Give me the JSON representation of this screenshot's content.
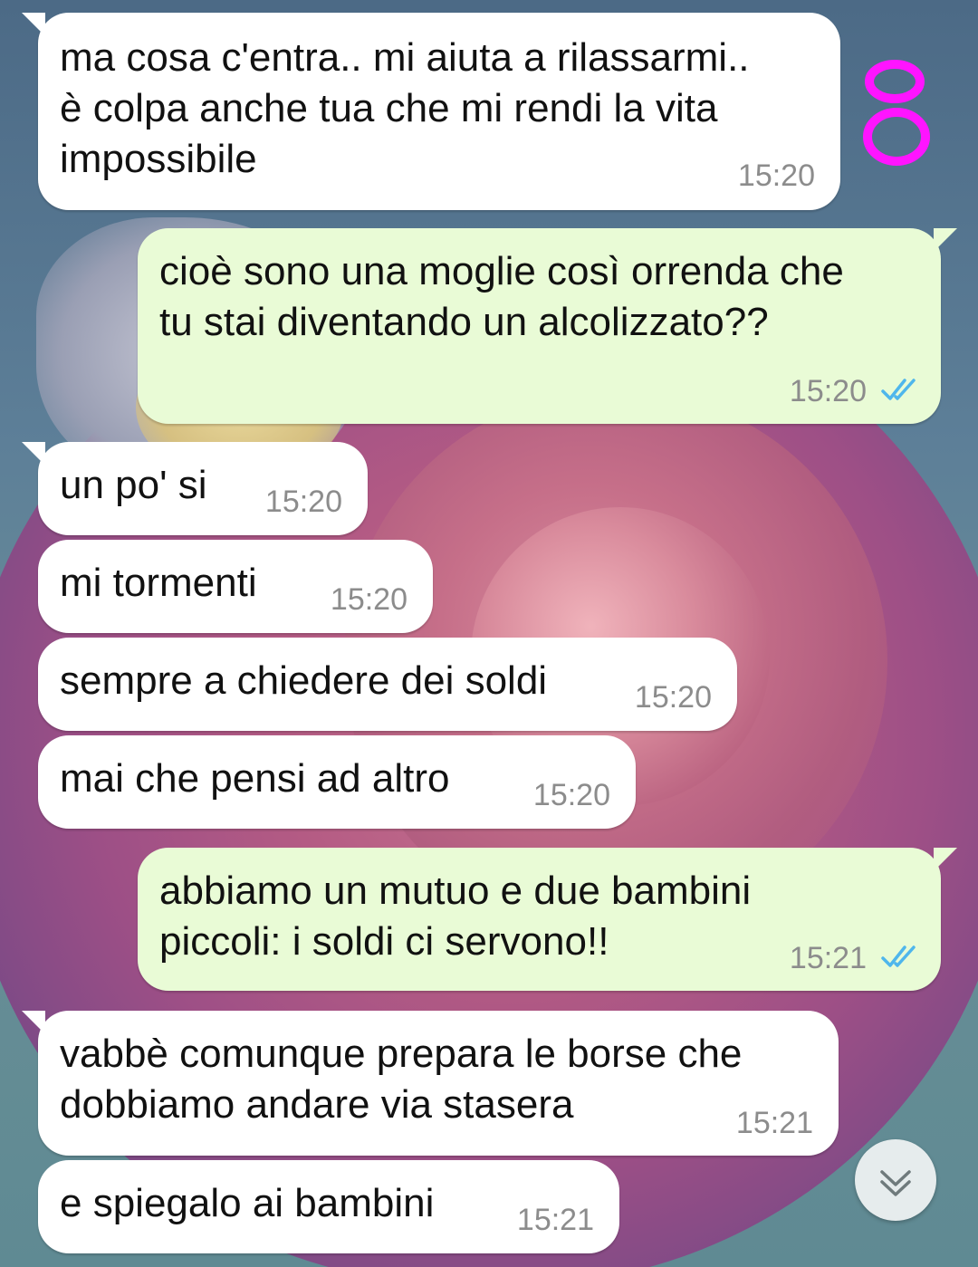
{
  "colors": {
    "incoming_bubble": "#ffffff",
    "outgoing_bubble": "#e9fbd6",
    "read_ticks": "#4fb6ec",
    "annotation": "#ff14ff"
  },
  "annotation": {
    "text": "8"
  },
  "messages": [
    {
      "text": "ma cosa c'entra.. mi aiuta a rilassarmi..\nè colpa anche tua che mi rendi la vita\nimpossibile",
      "time": "15:20"
    },
    {
      "text": "cioè sono una moglie così orrenda che\ntu stai diventando un alcolizzato??",
      "time": "15:20",
      "status": "read"
    },
    {
      "text": "un po' si",
      "time": "15:20"
    },
    {
      "text": "mi tormenti",
      "time": "15:20"
    },
    {
      "text": "sempre a chiedere dei soldi",
      "time": "15:20"
    },
    {
      "text": "mai che pensi ad altro",
      "time": "15:20"
    },
    {
      "text": "abbiamo un mutuo e due bambini\npiccoli: i soldi ci servono!!",
      "time": "15:21",
      "status": "read"
    },
    {
      "text": "vabbè comunque prepara le borse che\ndobbiamo andare via stasera",
      "time": "15:21"
    },
    {
      "text": "e spiegalo ai bambini",
      "time": "15:21"
    }
  ],
  "scroll_button": {
    "icon": "double-chevron-down-icon"
  }
}
